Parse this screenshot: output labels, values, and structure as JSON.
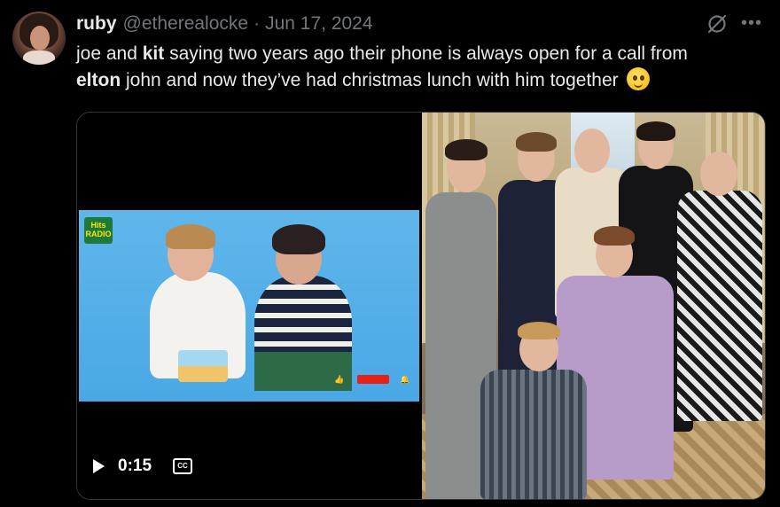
{
  "tweet": {
    "display_name": "ruby",
    "handle": "@etherealocke",
    "separator": "·",
    "date": "Jun 17, 2024",
    "text_parts": {
      "t1": "joe and ",
      "b1": "kit",
      "t2": " saying two years ago their phone is always open for a call from",
      "b2": "elton",
      "t3": " john and now they’ve had christmas lunch with him together"
    },
    "emoji": "holding-back-tears-emoji"
  },
  "video": {
    "time": "0:15",
    "play_icon": "play-icon",
    "cc_label": "CC",
    "logo_text": "Hits RADIO"
  },
  "colors": {
    "background": "#000000",
    "text": "#e7e9ea",
    "muted": "#71767b",
    "border": "#333639"
  }
}
